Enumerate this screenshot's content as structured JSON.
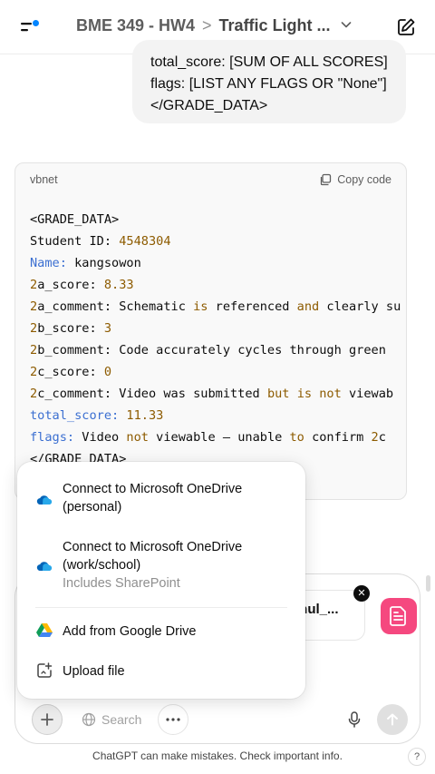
{
  "header": {
    "project": "BME 349 - HW4",
    "separator": ">",
    "chat_title": "Traffic Light ..."
  },
  "user_message": {
    "lines": [
      "total_score: [SUM OF ALL SCORES]",
      "flags: [LIST ANY FLAGS OR \"None\"]",
      "</GRADE_DATA>"
    ]
  },
  "code_block": {
    "language": "vbnet",
    "copy_label": "Copy code",
    "lines": [
      "<GRADE_DATA>",
      "Student ID: 4548304",
      "Name: kangsowon",
      "2a_score: 8.33",
      "2a_comment: Schematic is referenced and clearly su",
      "2b_score: 3",
      "2b_comment: Code accurately cycles through green",
      "2c_score: 0",
      "2c_comment: Video was submitted but is not viewab",
      "total_score: 11.33",
      "flags: Video not viewable — unable to confirm 2c",
      "</GRADE_DATA>"
    ]
  },
  "attachment": {
    "name": "rahul_..."
  },
  "menu": {
    "items": [
      {
        "icon": "onedrive-icon",
        "label_1": "Connect to Microsoft OneDrive",
        "label_2": "(personal)"
      },
      {
        "icon": "onedrive-icon",
        "label_1": "Connect to Microsoft OneDrive",
        "label_2": "(work/school)",
        "sub": "Includes SharePoint"
      },
      {
        "icon": "google-drive-icon",
        "label": "Add from Google Drive"
      },
      {
        "icon": "upload-file-icon",
        "label": "Upload file"
      }
    ]
  },
  "composer": {
    "search_label": "Search"
  },
  "footer": {
    "disclaimer": "ChatGPT can make mistakes. Check important info.",
    "help": "?"
  },
  "colors": {
    "accent_blue": "#0285ff",
    "pdf_pink": "#f5487f",
    "code_keyword": "#8d5b00",
    "code_blue": "#3b6fd1"
  }
}
